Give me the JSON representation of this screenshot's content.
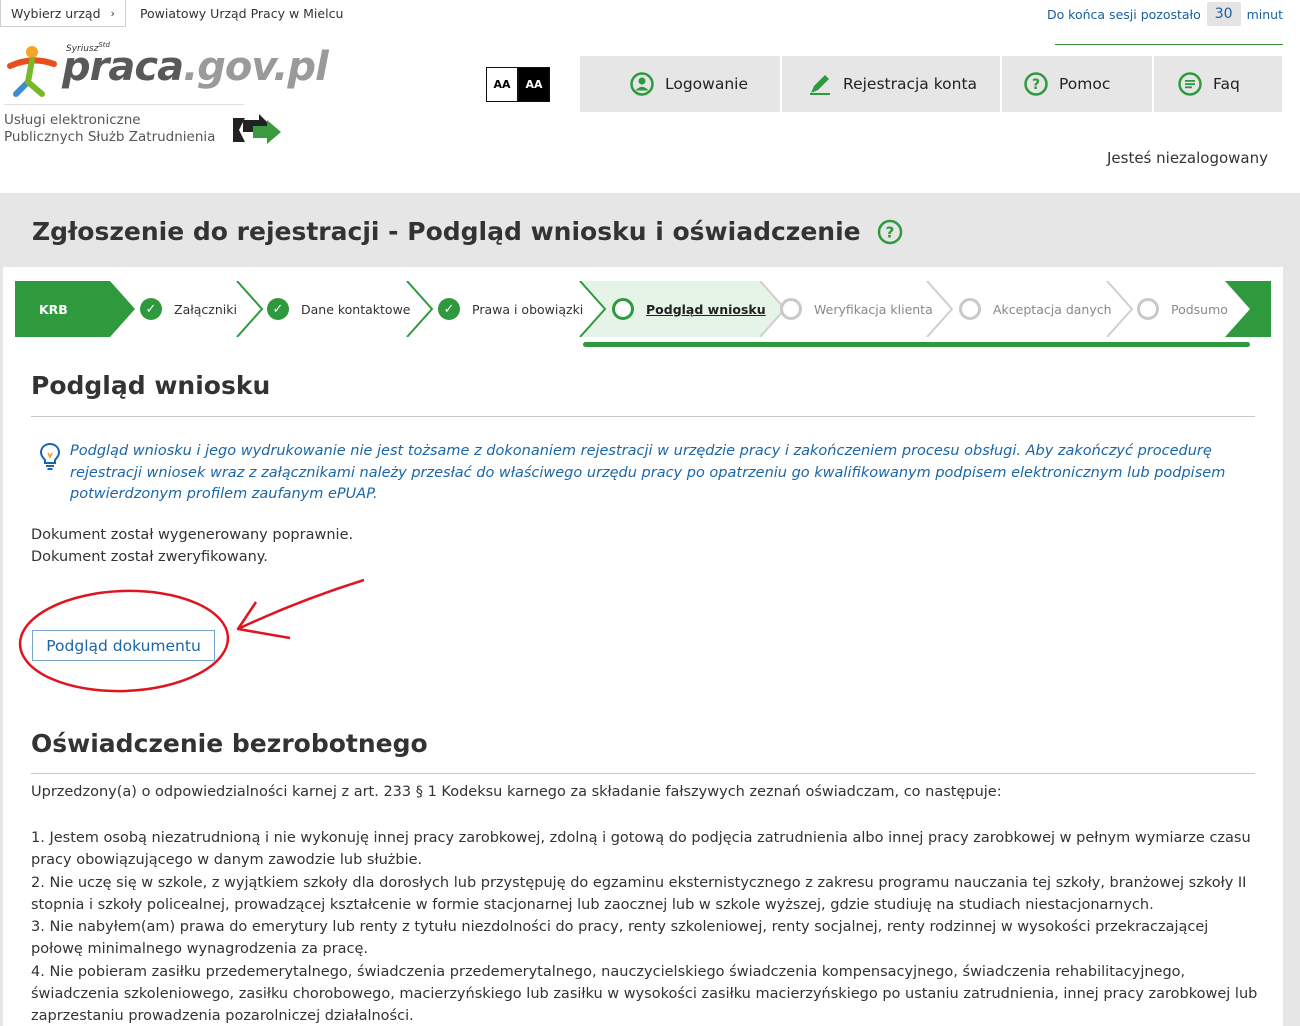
{
  "header": {
    "office_select_label": "Wybierz urząd",
    "office_name": "Powiatowy Urząd Pracy w Mielcu",
    "session_prefix": "Do końca sesji pozostało",
    "session_minutes": "30",
    "session_suffix": "minut",
    "logo_main": "praca",
    "logo_domain": ".gov.pl",
    "logo_sup": "Syriusz",
    "logo_sup_small": "Std",
    "services_line1": "Usługi elektroniczne",
    "services_line2": "Publicznych Służb Zatrudnienia",
    "contrast_normal": "AA",
    "contrast_high": "AA",
    "login_status": "Jesteś niezalogowany"
  },
  "nav": {
    "items": [
      {
        "label": "Logowanie",
        "icon": "user-icon"
      },
      {
        "label": "Rejestracja konta",
        "icon": "pencil-icon"
      },
      {
        "label": "Pomoc",
        "icon": "help-icon"
      },
      {
        "label": "Faq",
        "icon": "chat-icon"
      }
    ]
  },
  "page": {
    "title": "Zgłoszenie do rejestracji - Podgląd wniosku i oświadczenie"
  },
  "steps": {
    "first": "KRB",
    "items": [
      {
        "label": "Załączniki",
        "state": "done"
      },
      {
        "label": "Dane kontaktowe",
        "state": "done"
      },
      {
        "label": "Prawa i obowiązki",
        "state": "done"
      },
      {
        "label": "Podgląd wniosku",
        "state": "current"
      },
      {
        "label": "Weryfikacja klienta",
        "state": "pending"
      },
      {
        "label": "Akceptacja danych",
        "state": "pending"
      },
      {
        "label": "Podsumo",
        "state": "pending"
      }
    ]
  },
  "preview": {
    "heading": "Podgląd wniosku",
    "info": "Podgląd wniosku i jego wydrukowanie nie jest tożsame z dokonaniem rejestracji w urzędzie pracy i zakończeniem procesu obsługi. Aby zakończyć procedurę rejestracji wniosek wraz z załącznikami należy przesłać do właściwego urzędu pracy po opatrzeniu go kwalifikowanym podpisem elektronicznym lub podpisem potwierdzonym profilem zaufanym ePUAP.",
    "status1": "Dokument został wygenerowany poprawnie.",
    "status2": "Dokument został zweryfikowany.",
    "button": "Podgląd dokumentu"
  },
  "declaration": {
    "heading": "Oświadczenie bezrobotnego",
    "intro": "Uprzedzony(a) o odpowiedzialności karnej z art. 233 § 1 Kodeksu karnego za składanie fałszywych zeznań oświadczam, co następuje:",
    "items": [
      "1. Jestem osobą niezatrudnioną i nie wykonuję innej pracy zarobkowej, zdolną i gotową do podjęcia zatrudnienia albo innej pracy zarobkowej w pełnym wymiarze czasu pracy obowiązującego w danym zawodzie lub służbie.",
      "2. Nie uczę się w szkole, z wyjątkiem szkoły dla dorosłych lub przystępuję do egzaminu eksternistycznego z zakresu programu nauczania tej szkoły, branżowej szkoły II stopnia i szkoły policealnej, prowadzącej kształcenie w formie stacjonarnej lub zaocznej lub w szkole wyższej, gdzie studiuję na studiach niestacjonarnych.",
      "3. Nie nabyłem(am) prawa do emerytury lub renty z tytułu niezdolności do pracy, renty szkoleniowej, renty socjalnej, renty rodzinnej w wysokości przekraczającej połowę minimalnego wynagrodzenia za pracę.",
      "4. Nie pobieram zasiłku przedemerytalnego, świadczenia przedemerytalnego, nauczycielskiego świadczenia kompensacyjnego, świadczenia rehabilitacyjnego, świadczenia szkoleniowego, zasiłku chorobowego, macierzyńskiego lub zasiłku w wysokości zasiłku macierzyńskiego po ustaniu zatrudnienia, innej pracy zarobkowej lub zaprzestaniu prowadzenia pozarolniczej działalności."
    ]
  },
  "colors": {
    "green": "#2f9a3d",
    "blue_text": "#1a66a8",
    "annotation_red": "#e0141e"
  }
}
